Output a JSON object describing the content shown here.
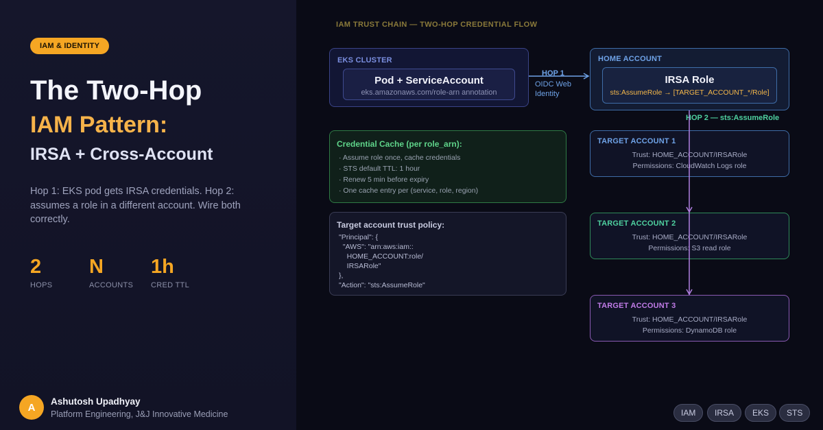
{
  "badge": "IAM & IDENTITY",
  "title": {
    "line1": "The Two-Hop",
    "line2": "IAM Pattern:",
    "line3": "IRSA + Cross-Account"
  },
  "description": "Hop 1: EKS pod gets IRSA credentials. Hop 2: assumes a role in a different account. Wire both correctly.",
  "stats": [
    {
      "value": "2",
      "label": "HOPS"
    },
    {
      "value": "N",
      "label": "ACCOUNTS"
    },
    {
      "value": "1h",
      "label": "CRED TTL"
    }
  ],
  "author": {
    "initial": "A",
    "name": "Ashutosh Upadhyay",
    "role": "Platform Engineering, J&J Innovative Medicine"
  },
  "diagram": {
    "title": "IAM TRUST CHAIN — TWO-HOP CREDENTIAL FLOW",
    "eks": {
      "label": "EKS CLUSTER",
      "pod_title": "Pod + ServiceAccount",
      "pod_sub": "eks.amazonaws.com/role-arn annotation"
    },
    "hop1": {
      "label": "HOP 1",
      "sub": "OIDC Web Identity"
    },
    "home": {
      "label": "HOME ACCOUNT",
      "role_title": "IRSA Role",
      "role_sub": "sts:AssumeRole → [TARGET_ACCOUNT_*/Role]"
    },
    "hop2": {
      "label": "HOP 2 — sts:AssumeRole"
    },
    "cache": {
      "title": "Credential Cache (per role_arn):",
      "items": [
        "· Assume role once, cache credentials",
        "· STS default TTL: 1 hour",
        "· Renew 5 min before expiry",
        "· One cache entry per (service, role, region)"
      ]
    },
    "policy": {
      "title": "Target account trust policy:",
      "code": "\"Principal\": {\n  \"AWS\": \"arn:aws:iam::\n    HOME_ACCOUNT:role/\n    IRSARole\"\n},\n\"Action\": \"sts:AssumeRole\""
    },
    "targets": [
      {
        "label": "TARGET ACCOUNT 1",
        "trust": "Trust: HOME_ACCOUNT/IRSARole",
        "permissions": "Permissions: CloudWatch Logs role"
      },
      {
        "label": "TARGET ACCOUNT 2",
        "trust": "Trust: HOME_ACCOUNT/IRSARole",
        "permissions": "Permissions: S3 read role"
      },
      {
        "label": "TARGET ACCOUNT 3",
        "trust": "Trust: HOME_ACCOUNT/IRSARole",
        "permissions": "Permissions: DynamoDB role"
      }
    ]
  },
  "tags": [
    "IAM",
    "IRSA",
    "EKS",
    "STS"
  ],
  "colors": {
    "accent": "#f5a623",
    "hop1": "#6fa3e8",
    "hop2": "#4fd1a0",
    "chain_line": "#b07fe0"
  }
}
